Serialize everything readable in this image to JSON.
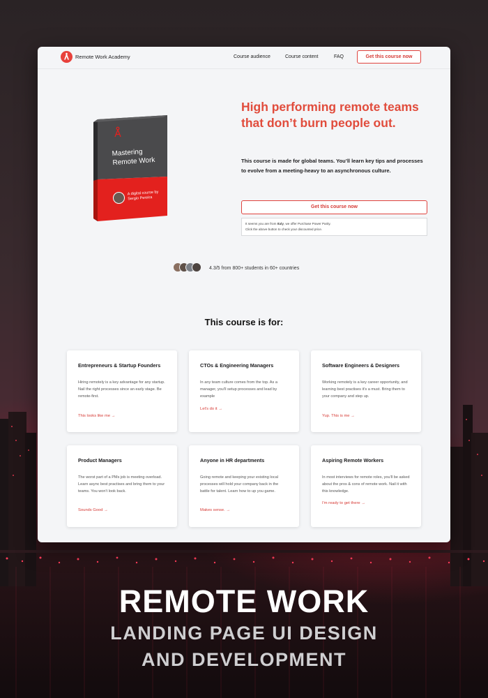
{
  "nav": {
    "brand": "Remote Work Academy",
    "links": [
      "Course audience",
      "Course content",
      "FAQ"
    ],
    "cta": "Get this course now"
  },
  "product": {
    "title_line1": "Mastering",
    "title_line2": "Remote Work",
    "subtitle_line1": "A digital course by",
    "subtitle_line2": "Sergio Pereira"
  },
  "hero": {
    "title": "High performing remote teams that don’t burn people out.",
    "description": "This course is made for global teams. You’ll learn key tips and processes to evolve from a meeting-heavy to an asynchronous culture.",
    "cta": "Get this course now",
    "ppp_prefix": "It seems you are from ",
    "ppp_country": "Italy",
    "ppp_suffix": ", we offer Purchase Power Parity.",
    "ppp_line2": "Click the above button to check your discounted price."
  },
  "social_proof": {
    "rating": "4.3/5 from 800+ students in 60+ countries"
  },
  "audience": {
    "title": "This course is for:",
    "cards": [
      {
        "title": "Entrepreneurs & Startup Founders",
        "body": "Hiring remotely is a key advantage for any startup. Nail the right processes since an early stage. Be remote-first.",
        "link": "This looks like me →"
      },
      {
        "title": "CTOs & Engineering Managers",
        "body": "In any team culture comes from the top. As a manager, you'll setup processes and lead by example",
        "link": "Let's do it →"
      },
      {
        "title": "Software Engineers & Designers",
        "body": "Working remotely is a key career opportunity, and learning best practises it's a must. Bring them to your company and step up.",
        "link": "Yup. This is me →"
      },
      {
        "title": "Product Managers",
        "body": "The worst part of a PMs job is meeting overload. Learn async best practises and bring them to your teams. You won't look back.",
        "link": "Sounds Good →"
      },
      {
        "title": "Anyone in HR departments",
        "body": "Going remote and keeping your existing local processes will hold your company back in the battle for talent. Learn how to up you game.",
        "link": "Makes sense. →"
      },
      {
        "title": "Aspiring Remote Workers",
        "body": "In most interviews for remote roles, you'll be asked about the pros & cons of remote work. Nail it with this knowledge.",
        "link": "I'm ready to get there →"
      }
    ]
  },
  "footer": {
    "title": "REMOTE WORK",
    "line1": "LANDING PAGE UI DESIGN",
    "line2": "AND DEVELOPMENT"
  },
  "colors": {
    "accent": "#e14c3c",
    "page_bg": "#f4f5f7"
  },
  "icons": [
    "logo-icon",
    "arrow-right-icon"
  ]
}
